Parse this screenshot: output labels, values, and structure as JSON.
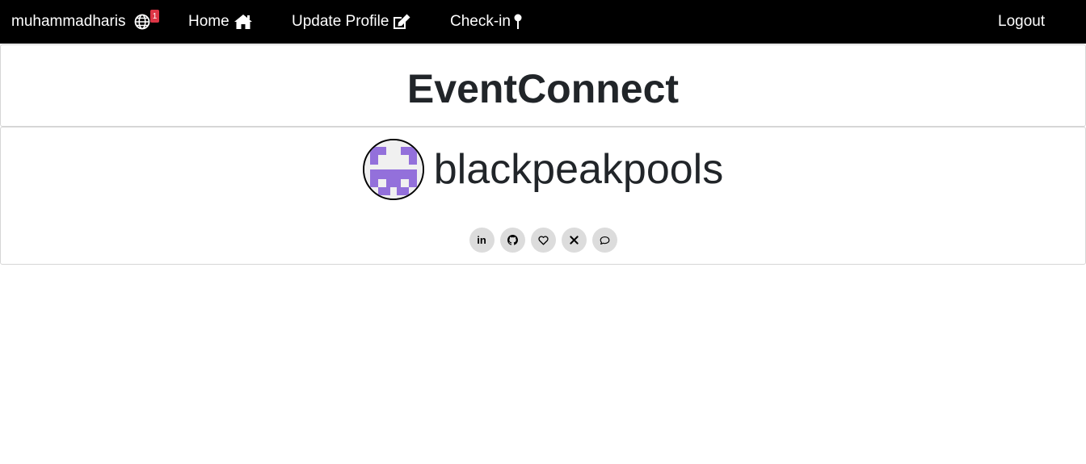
{
  "navbar": {
    "username": "muhammadharis",
    "notification_count": "1",
    "home_label": "Home",
    "update_profile_label": "Update Profile",
    "checkin_label": "Check-in",
    "logout_label": "Logout",
    "globe_icon": "globe-icon",
    "home_icon": "home-icon",
    "edit_icon": "edit-icon",
    "pin_icon": "map-pin-icon"
  },
  "title": {
    "text": "EventConnect"
  },
  "profile": {
    "username": "blackpeakpools",
    "avatar": "identicon-avatar",
    "avatar_color": "#9370db",
    "social_links": [
      {
        "icon": "linkedin-icon",
        "text": "in"
      },
      {
        "icon": "github-icon"
      },
      {
        "icon": "heart-icon"
      },
      {
        "icon": "x-icon"
      },
      {
        "icon": "chat-bubble-icon"
      }
    ]
  },
  "colors": {
    "navbar_bg": "#000000",
    "badge_bg": "#dc3545",
    "social_btn_bg": "#dcdcdc"
  }
}
